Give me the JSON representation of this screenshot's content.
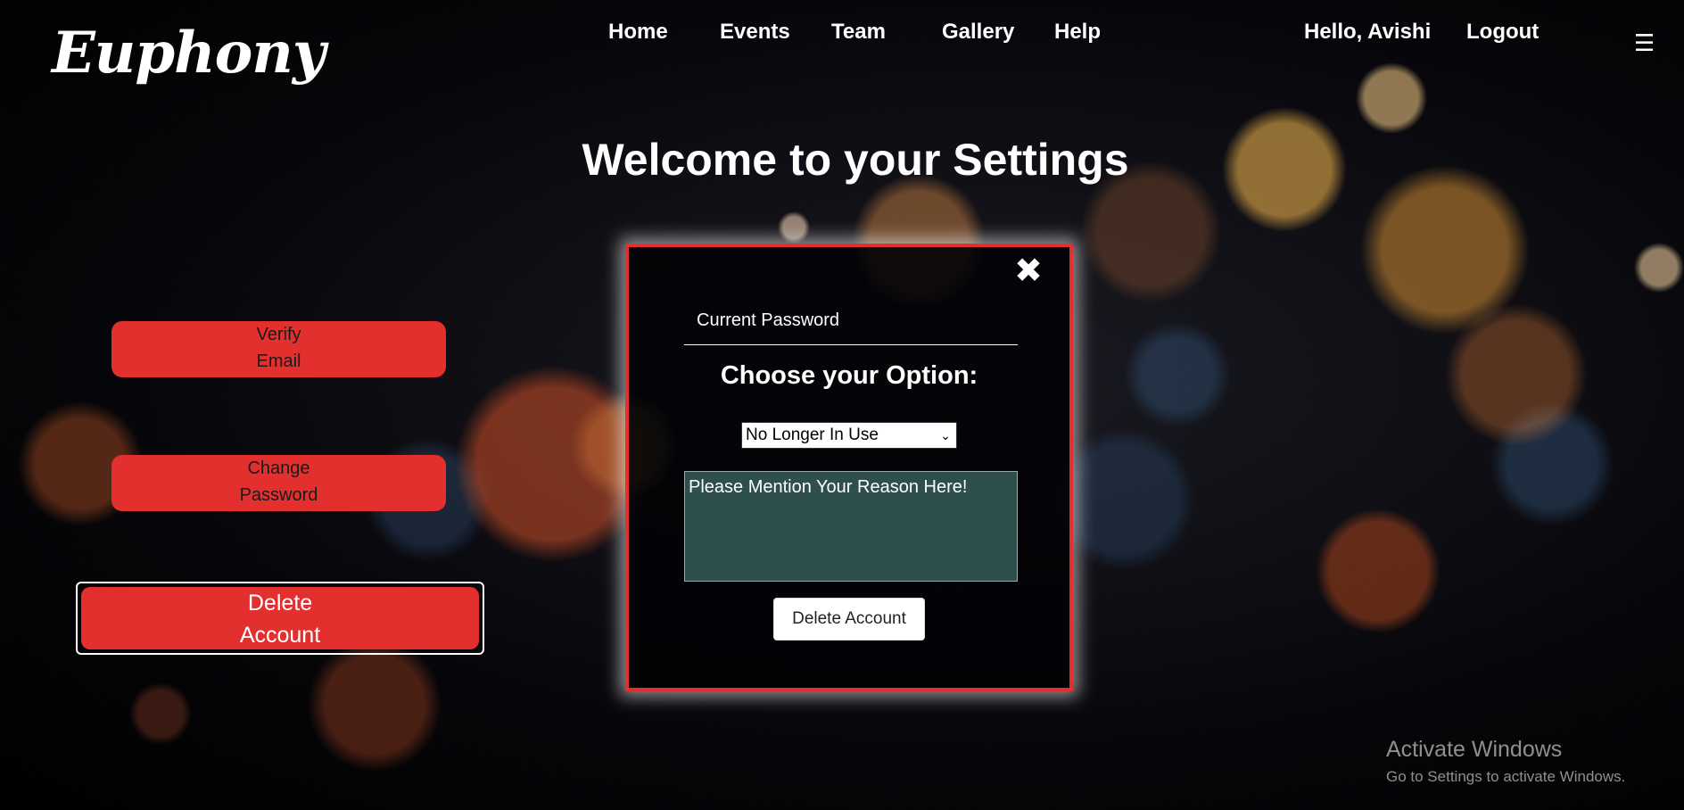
{
  "header": {
    "logo": "Euphony",
    "nav": [
      "Home",
      "Events",
      "Team",
      "Gallery",
      "Help"
    ],
    "greeting": "Hello, Avishi",
    "logout": "Logout",
    "menu_icon": "☰"
  },
  "title": "Welcome to your Settings",
  "side_buttons": {
    "verify": [
      "Verify",
      "Email"
    ],
    "change": [
      "Change",
      "Password"
    ],
    "delete": [
      "Delete",
      "Account"
    ]
  },
  "modal": {
    "close_icon": "✖",
    "password_placeholder": "Current Password",
    "heading": "Choose your Option:",
    "selected_option": "No Longer In Use",
    "caret": "⌄",
    "reason_text": "Please Mention Your Reason Here!",
    "submit_label": "Delete Account"
  },
  "watermark": {
    "line1": "Activate Windows",
    "line2": "Go to Settings to activate Windows."
  },
  "colors": {
    "accent": "#e3302f",
    "textarea_bg": "#2f4f4f"
  }
}
